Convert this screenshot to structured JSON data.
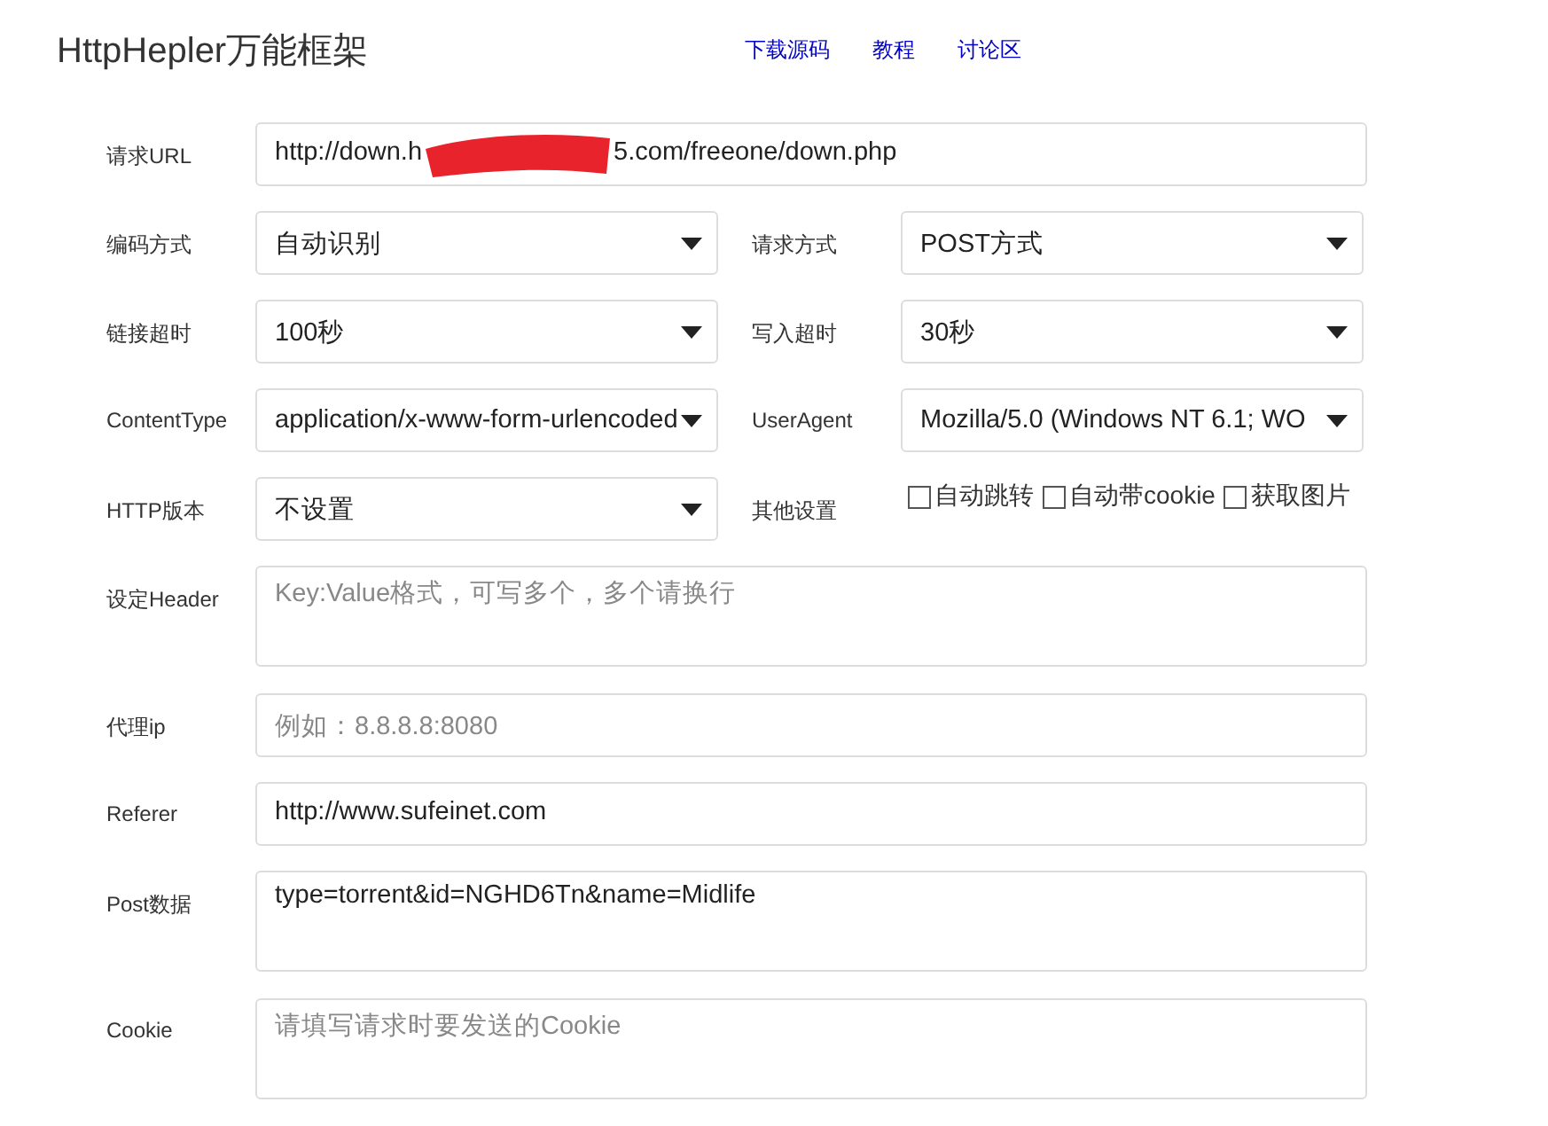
{
  "header": {
    "title": "HttpHepler万能框架",
    "links": [
      "下载源码",
      "教程",
      "讨论区"
    ]
  },
  "rows": [
    {
      "kind": "redacted",
      "label": "请求URL",
      "parts": [
        "http://down.h",
        "5.com/freeone/down.php"
      ]
    },
    {
      "kind": "pair",
      "fields": [
        {
          "label": "编码方式",
          "value": "自动识别"
        },
        {
          "label": "请求方式",
          "value": "POST方式"
        }
      ]
    },
    {
      "kind": "pair",
      "fields": [
        {
          "label": "链接超时",
          "value": "100秒"
        },
        {
          "label": "写入超时",
          "value": "30秒"
        }
      ]
    },
    {
      "kind": "pair",
      "fields": [
        {
          "label": "ContentType",
          "value": "application/x-www-form-urlencoded"
        },
        {
          "label": "UserAgent",
          "value": "Mozilla/5.0 (Windows NT 6.1; WO"
        }
      ]
    },
    {
      "kind": "options",
      "label": "HTTP版本",
      "value": "不设置",
      "label2": "其他设置",
      "checkboxes": [
        {
          "label": "自动跳转",
          "checked": false
        },
        {
          "label": "自动带cookie",
          "checked": false
        },
        {
          "label": "获取图片",
          "checked": false
        }
      ]
    },
    {
      "kind": "textarea",
      "label": "设定Header",
      "placeholder": "Key:Value格式，可写多个，多个请换行"
    },
    {
      "kind": "text",
      "label": "代理ip",
      "placeholder": "例如：8.8.8.8:8080"
    },
    {
      "kind": "text",
      "label": "Referer",
      "value": "http://www.sufeinet.com"
    },
    {
      "kind": "textarea",
      "label": "Post数据",
      "value": "type=torrent&id=NGHD6Tn&name=Midlife"
    },
    {
      "kind": "textarea",
      "label": "Cookie",
      "placeholder": "请填写请求时要发送的Cookie"
    }
  ]
}
